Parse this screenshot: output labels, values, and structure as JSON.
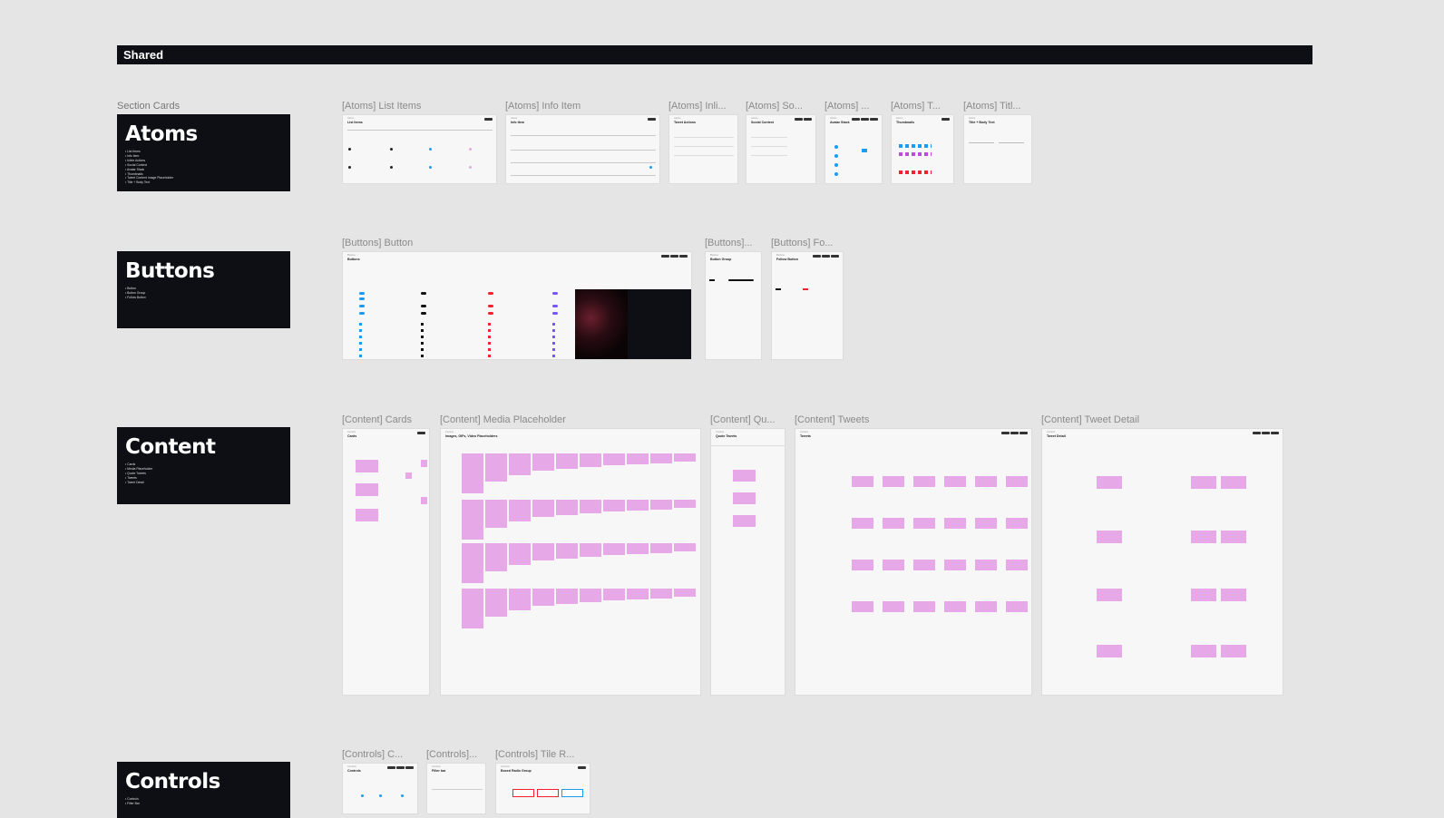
{
  "shared": {
    "title": "Shared"
  },
  "section_caption": "Section Cards",
  "sections": [
    {
      "title": "Atoms",
      "items": [
        "List Items",
        "Info Item",
        "Inline Actions",
        "Social Context",
        "Avatar Stack",
        "Thumbnails",
        "Tweet Content Image Placeholder",
        "Title + Body Text"
      ]
    },
    {
      "title": "Buttons",
      "items": [
        "Button",
        "Button Group",
        "Follow Button"
      ]
    },
    {
      "title": "Content",
      "items": [
        "Cards",
        "Media Placeholder",
        "Quote Tweets",
        "Tweets",
        "Tweet Detail"
      ]
    },
    {
      "title": "Controls",
      "items": [
        "Controls",
        "Filter Bar"
      ]
    }
  ],
  "frames": {
    "atoms": [
      {
        "label": "[Atoms] List Items",
        "title": "List Items"
      },
      {
        "label": "[Atoms] Info Item",
        "title": "Info Item"
      },
      {
        "label": "[Atoms] Inli...",
        "title": "Tweet Actions"
      },
      {
        "label": "[Atoms] So...",
        "title": "Social Context"
      },
      {
        "label": "[Atoms] ...",
        "title": "Avatar Stack"
      },
      {
        "label": "[Atoms] T...",
        "title": "Thumbnails"
      },
      {
        "label": "[Atoms] Titl...",
        "title": "Title + Body Text"
      }
    ],
    "buttons": [
      {
        "label": "[Buttons] Button",
        "title": "Buttons"
      },
      {
        "label": "[Buttons]...",
        "title": "Button Group"
      },
      {
        "label": "[Buttons] Fo...",
        "title": "Follow Button"
      }
    ],
    "content": [
      {
        "label": "[Content] Cards",
        "title": "Cards"
      },
      {
        "label": "[Content] Media Placeholder",
        "title": "Images, GIFs, Video Placeholders"
      },
      {
        "label": "[Content] Qu...",
        "title": "Quote Tweets"
      },
      {
        "label": "[Content] Tweets",
        "title": "Tweets"
      },
      {
        "label": "[Content] Tweet Detail",
        "title": "Tweet Detail"
      }
    ],
    "controls": [
      {
        "label": "[Controls] C...",
        "title": "Controls"
      },
      {
        "label": "[Controls]...",
        "title": "Filter bar"
      },
      {
        "label": "[Controls] Tile R...",
        "title": "Boxed Radio Group"
      }
    ]
  },
  "colors": {
    "card_bg": "#0d0f14",
    "canvas_bg": "#e5e5e5",
    "accent_blue": "#1d9bf0",
    "accent_red": "#f4212e",
    "accent_purple": "#7856ff",
    "placeholder_pink": "#e6a8e6"
  }
}
